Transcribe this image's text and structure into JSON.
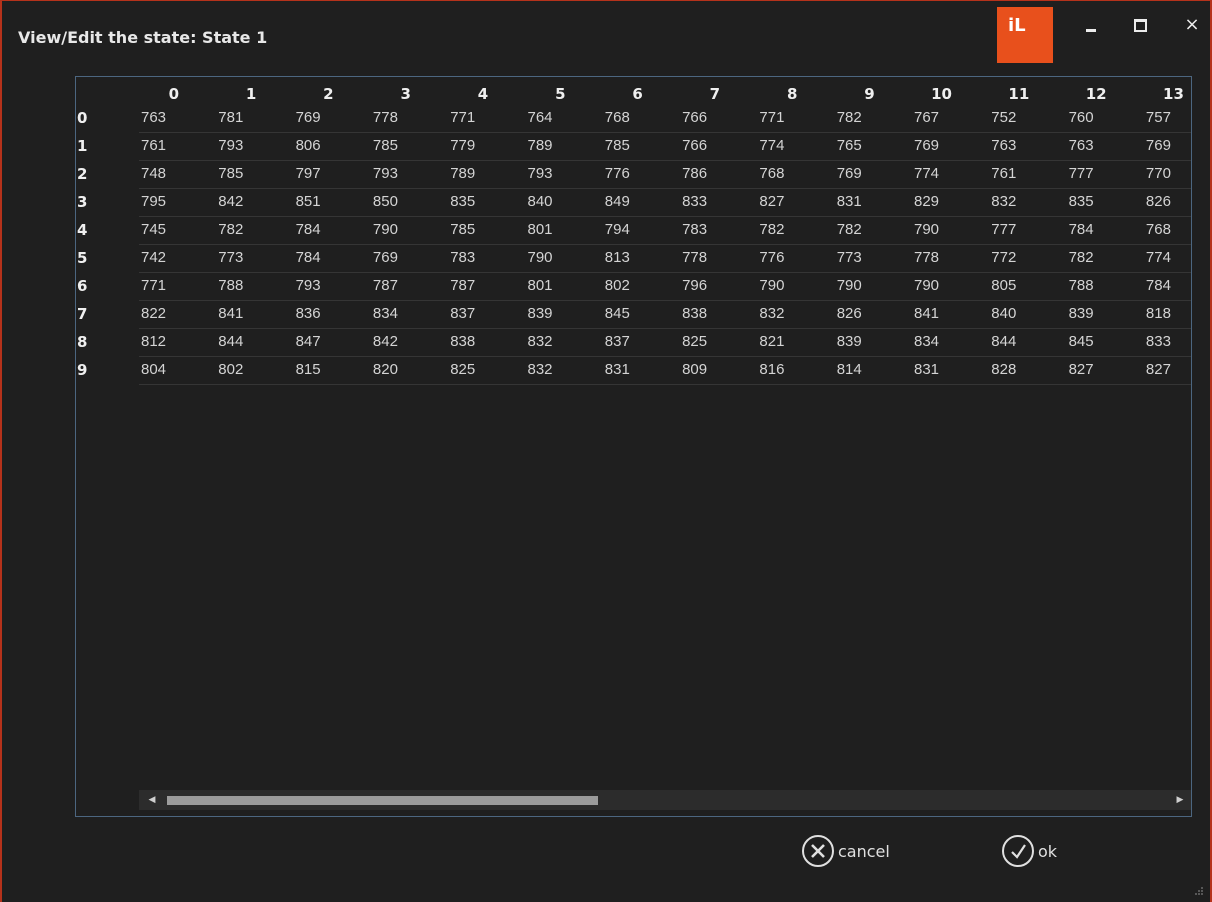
{
  "window": {
    "title": "View/Edit the state: State 1",
    "logo_text": "iL",
    "accent": "#e8501c",
    "border_color": "#b5321b"
  },
  "controls": {
    "minimize": "minimize-icon",
    "maximize": "maximize-icon",
    "close_symbol": "×"
  },
  "grid": {
    "columns": [
      "0",
      "1",
      "2",
      "3",
      "4",
      "5",
      "6",
      "7",
      "8",
      "9",
      "10",
      "11",
      "12",
      "13"
    ],
    "rows": [
      {
        "label": "0",
        "values": [
          "763",
          "781",
          "769",
          "778",
          "771",
          "764",
          "768",
          "766",
          "771",
          "782",
          "767",
          "752",
          "760",
          "757"
        ]
      },
      {
        "label": "1",
        "values": [
          "761",
          "793",
          "806",
          "785",
          "779",
          "789",
          "785",
          "766",
          "774",
          "765",
          "769",
          "763",
          "763",
          "769"
        ]
      },
      {
        "label": "2",
        "values": [
          "748",
          "785",
          "797",
          "793",
          "789",
          "793",
          "776",
          "786",
          "768",
          "769",
          "774",
          "761",
          "777",
          "770"
        ]
      },
      {
        "label": "3",
        "values": [
          "795",
          "842",
          "851",
          "850",
          "835",
          "840",
          "849",
          "833",
          "827",
          "831",
          "829",
          "832",
          "835",
          "826"
        ]
      },
      {
        "label": "4",
        "values": [
          "745",
          "782",
          "784",
          "790",
          "785",
          "801",
          "794",
          "783",
          "782",
          "782",
          "790",
          "777",
          "784",
          "768"
        ]
      },
      {
        "label": "5",
        "values": [
          "742",
          "773",
          "784",
          "769",
          "783",
          "790",
          "813",
          "778",
          "776",
          "773",
          "778",
          "772",
          "782",
          "774"
        ]
      },
      {
        "label": "6",
        "values": [
          "771",
          "788",
          "793",
          "787",
          "787",
          "801",
          "802",
          "796",
          "790",
          "790",
          "790",
          "805",
          "788",
          "784"
        ]
      },
      {
        "label": "7",
        "values": [
          "822",
          "841",
          "836",
          "834",
          "837",
          "839",
          "845",
          "838",
          "832",
          "826",
          "841",
          "840",
          "839",
          "818"
        ]
      },
      {
        "label": "8",
        "values": [
          "812",
          "844",
          "847",
          "842",
          "838",
          "832",
          "837",
          "825",
          "821",
          "839",
          "834",
          "844",
          "845",
          "833"
        ]
      },
      {
        "label": "9",
        "values": [
          "804",
          "802",
          "815",
          "820",
          "825",
          "832",
          "831",
          "809",
          "816",
          "814",
          "831",
          "828",
          "827",
          "827"
        ]
      }
    ],
    "horizontal_scroll_fraction": 0.43
  },
  "buttons": {
    "cancel_label": "cancel",
    "ok_label": "ok"
  }
}
